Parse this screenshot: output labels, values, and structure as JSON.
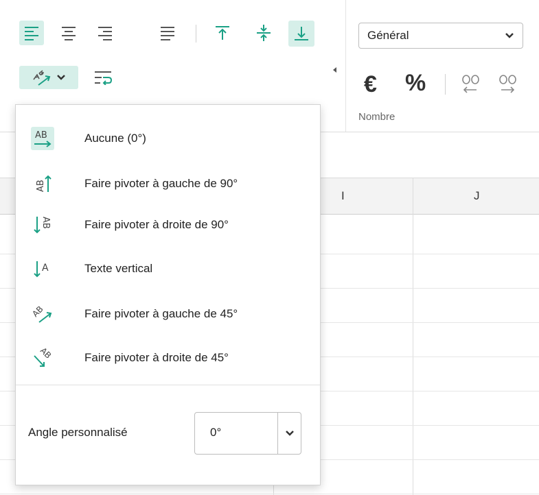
{
  "ribbon": {
    "number_format": {
      "selected": "Général"
    },
    "currency_symbol": "€",
    "percent_symbol": "%",
    "group_label": "Nombre"
  },
  "sheet": {
    "columns": [
      "I",
      "J"
    ]
  },
  "orientation_menu": {
    "items": [
      {
        "label": "Aucune (0°)",
        "icon": "text-horizontal-icon",
        "selected": true
      },
      {
        "label": "Faire pivoter à gauche de 90°",
        "icon": "rotate-up-icon"
      },
      {
        "label": "Faire pivoter à droite de 90°",
        "icon": "rotate-down-icon"
      },
      {
        "label": "Texte vertical",
        "icon": "vertical-text-icon"
      },
      {
        "label": "Faire pivoter à gauche de 45°",
        "icon": "angle-counterclockwise-icon"
      },
      {
        "label": "Faire pivoter à droite de 45°",
        "icon": "angle-clockwise-icon"
      }
    ],
    "custom_angle": {
      "label": "Angle personnalisé",
      "value": "0°"
    }
  },
  "colors": {
    "accent": "#1aa085",
    "active_bg": "#d6efe9",
    "icon_gray": "#555555"
  }
}
